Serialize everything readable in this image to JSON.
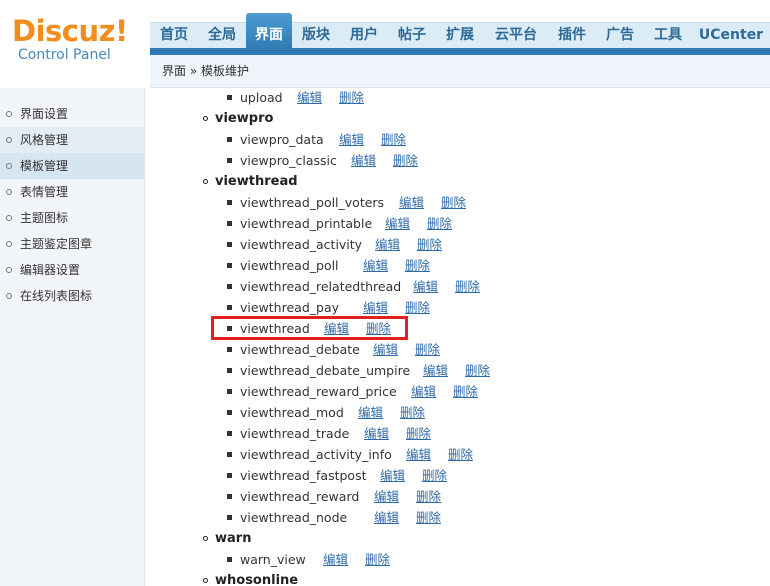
{
  "logo": {
    "brand": "Discuz!",
    "subtitle": "Control Panel"
  },
  "nav": {
    "items": [
      "首页",
      "全局",
      "界面",
      "版块",
      "用户",
      "帖子",
      "扩展",
      "云平台",
      "插件",
      "广告",
      "工具",
      "UCenter"
    ],
    "active": "界面"
  },
  "breadcrumb": "界面 » 模板维护",
  "sidebar": {
    "items": [
      "界面设置",
      "风格管理",
      "模板管理",
      "表情管理",
      "主题图标",
      "主题鉴定图章",
      "编辑器设置",
      "在线列表图标"
    ],
    "active": "模板管理"
  },
  "actions": {
    "edit": "编辑",
    "delete": "删除"
  },
  "templates": {
    "top_partial": "upload",
    "viewpro": {
      "name": "viewpro",
      "items": [
        "viewpro_data",
        "viewpro_classic"
      ]
    },
    "viewthread": {
      "name": "viewthread",
      "items": [
        "viewthread_poll_voters",
        "viewthread_printable",
        "viewthread_activity",
        "viewthread_poll",
        "viewthread_relatedthread",
        "viewthread_pay",
        "viewthread",
        "viewthread_debate",
        "viewthread_debate_umpire",
        "viewthread_reward_price",
        "viewthread_mod",
        "viewthread_trade",
        "viewthread_activity_info",
        "viewthread_fastpost",
        "viewthread_reward",
        "viewthread_node"
      ]
    },
    "warn": {
      "name": "warn",
      "items": [
        "warn_view"
      ]
    },
    "whosonline": {
      "name": "whosonline"
    }
  },
  "colors": {
    "accent": "#2f7ab4",
    "logo": "#f28d1d",
    "link": "#2f6aa8",
    "highlight": "#e2211c"
  }
}
